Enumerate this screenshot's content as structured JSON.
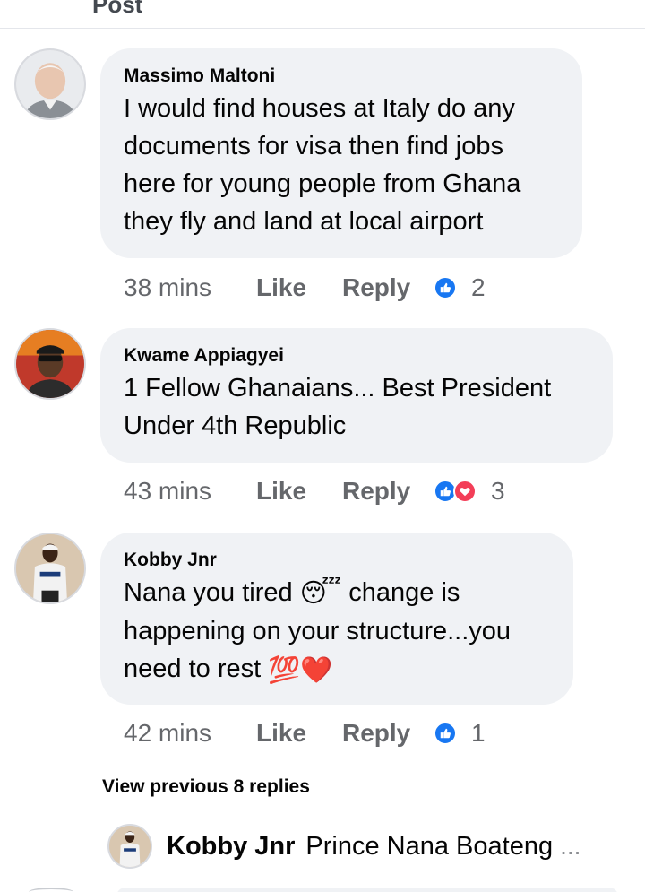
{
  "header": {
    "title": "Post"
  },
  "comments": [
    {
      "author": "Massimo Maltoni",
      "text": "I would find houses at Italy do any documents for visa then find jobs here for young people from Ghana they fly and land at local airport",
      "time": "38 mins",
      "like_label": "Like",
      "reply_label": "Reply",
      "reactions": [
        "like"
      ],
      "reaction_count": "2"
    },
    {
      "author": "Kwame Appiagyei",
      "text": "1 Fellow Ghanaians... Best President Under 4th Republic",
      "time": "43 mins",
      "like_label": "Like",
      "reply_label": "Reply",
      "reactions": [
        "like",
        "love"
      ],
      "reaction_count": "3"
    },
    {
      "author": "Kobby Jnr",
      "text_part1": "Nana you tired",
      "emoji1": "😴",
      "text_part2": "change is happening on your structure...you need to rest",
      "emoji2": "💯",
      "emoji3": "❤️",
      "time": "42 mins",
      "like_label": "Like",
      "reply_label": "Reply",
      "reactions": [
        "like"
      ],
      "reaction_count": "1"
    }
  ],
  "view_previous": "View previous 8 replies",
  "reply_preview": {
    "author": "Kobby Jnr",
    "text": "Prince Nana Boateng",
    "more": "..."
  },
  "colors": {
    "bubble": "#f0f2f5",
    "secondary_text": "#65676b",
    "like_blue": "#1877f2",
    "love_red": "#f33e58"
  }
}
